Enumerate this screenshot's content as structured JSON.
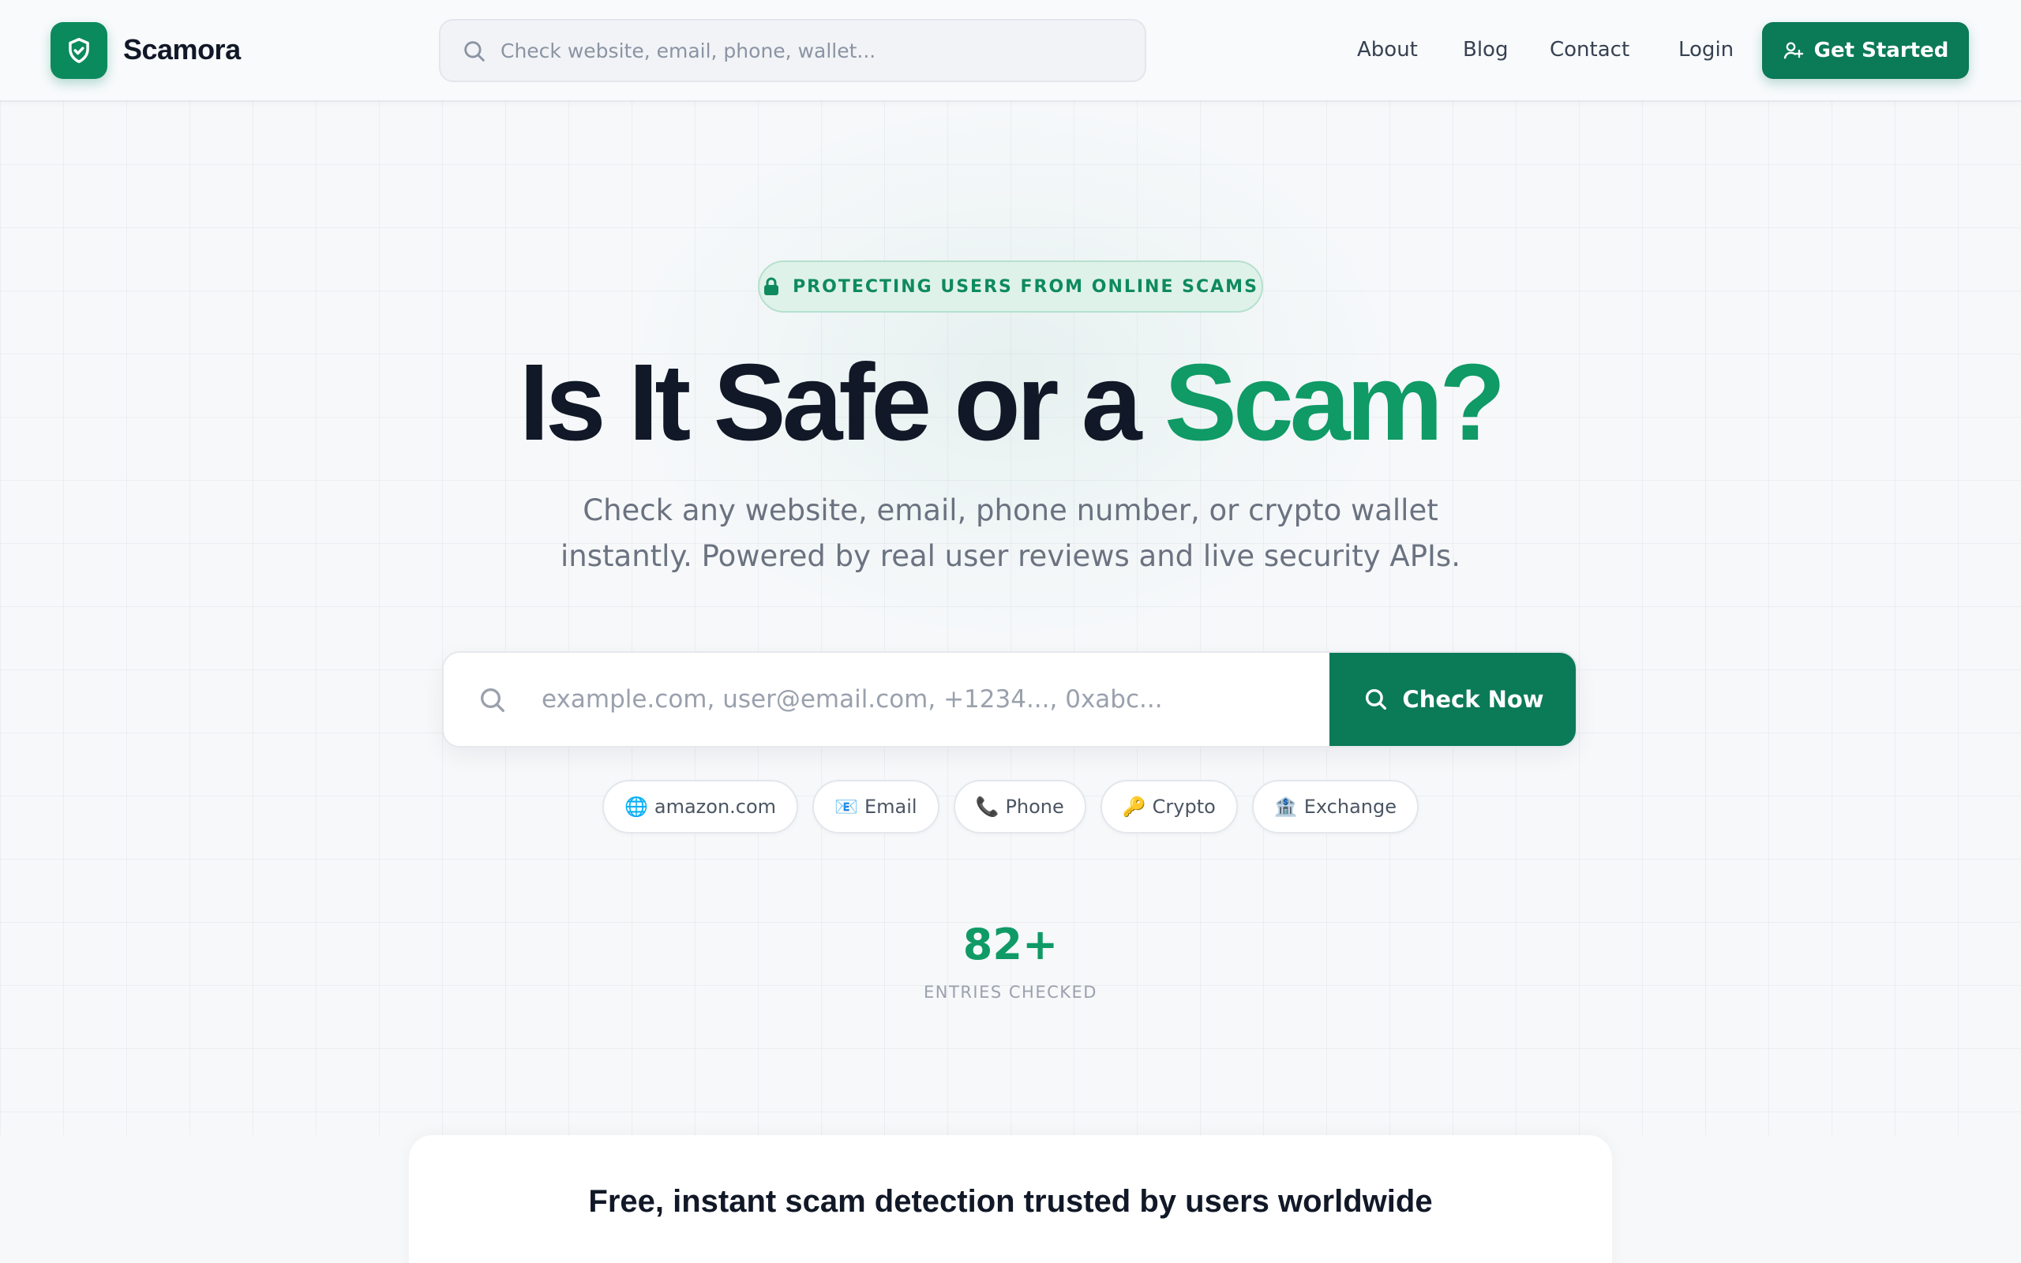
{
  "brand": {
    "name": "Scamora",
    "accent": "#0b7a56"
  },
  "header": {
    "search_placeholder": "Check website, email, phone, wallet...",
    "nav": [
      "About",
      "Blog",
      "Contact",
      "Login"
    ],
    "cta_label": "Get Started"
  },
  "hero": {
    "badge": "PROTECTING USERS FROM ONLINE SCAMS",
    "title_main": "Is It Safe or a ",
    "title_accent": "Scam?",
    "subtitle_line1": "Check any website, email, phone number, or crypto wallet",
    "subtitle_line2": "instantly. Powered by real user reviews and live security APIs.",
    "search_placeholder": "example.com, user@email.com, +1234..., 0xabc...",
    "check_label": "Check Now",
    "chips": [
      {
        "emoji": "🌐",
        "label": "amazon.com"
      },
      {
        "emoji": "📧",
        "label": "Email"
      },
      {
        "emoji": "📞",
        "label": "Phone"
      },
      {
        "emoji": "🔑",
        "label": "Crypto"
      },
      {
        "emoji": "🏦",
        "label": "Exchange"
      }
    ]
  },
  "stats": {
    "value": "82+",
    "label": "ENTRIES CHECKED"
  },
  "card": {
    "title": "Free, instant scam detection trusted by users worldwide"
  }
}
